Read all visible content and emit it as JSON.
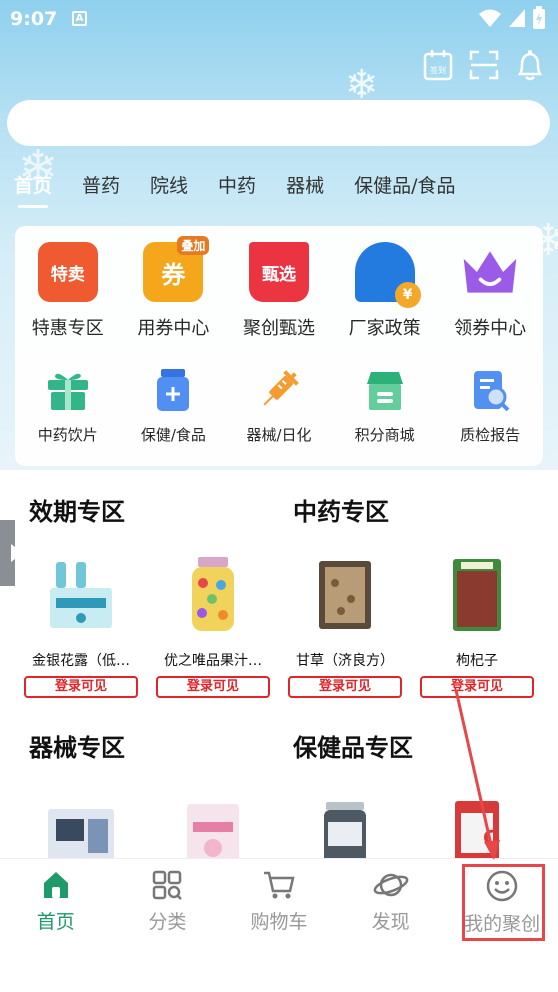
{
  "status": {
    "time": "9:07",
    "a_badge": "A"
  },
  "top_icons": {
    "sign_in": "签到"
  },
  "search": {
    "placeholder": ""
  },
  "category_tabs": [
    {
      "label": "首页",
      "active": true
    },
    {
      "label": "普药"
    },
    {
      "label": "院线"
    },
    {
      "label": "中药"
    },
    {
      "label": "器械"
    },
    {
      "label": "保健品/食品"
    }
  ],
  "shortcuts_big": [
    {
      "label": "特惠专区",
      "icon_text": "特卖",
      "icon": "sale-icon",
      "color": "#f0562a"
    },
    {
      "label": "用券中心",
      "icon_text": "券",
      "badge": "叠加",
      "icon": "coupon-icon",
      "color": "#f6a515"
    },
    {
      "label": "聚创甄选",
      "icon_text": "甄选",
      "icon": "cart-select-icon",
      "color": "#ec2f3c"
    },
    {
      "label": "厂家政策",
      "icon_text": "¥",
      "icon": "factory-policy-icon",
      "color": "#1e78e0"
    },
    {
      "label": "领券中心",
      "icon_text": "",
      "icon": "crown-icon",
      "color": "#9a57e8"
    }
  ],
  "shortcuts_small": [
    {
      "label": "中药饮片",
      "icon": "gift-box-icon",
      "color": "#2db586"
    },
    {
      "label": "保健/食品",
      "icon": "jar-icon",
      "color": "#4d8cf2"
    },
    {
      "label": "器械/日化",
      "icon": "syringe-icon",
      "color": "#f59a2a"
    },
    {
      "label": "积分商城",
      "icon": "store-icon",
      "color": "#27b074"
    },
    {
      "label": "质检报告",
      "icon": "report-icon",
      "color": "#4f8ef0"
    }
  ],
  "zones": [
    {
      "title": "效期专区",
      "products": [
        {
          "name": "金银花露（低…",
          "button": "登录可见"
        },
        {
          "name": "优之唯品果汁…",
          "button": "登录可见"
        }
      ]
    },
    {
      "title": "中药专区",
      "products": [
        {
          "name": "甘草（济良方）",
          "button": "登录可见"
        },
        {
          "name": "枸杞子",
          "button": "登录可见"
        }
      ]
    },
    {
      "title": "器械专区",
      "products": [
        {
          "name": ""
        },
        {
          "name": ""
        }
      ]
    },
    {
      "title": "保健品专区",
      "products": [
        {
          "name": ""
        },
        {
          "name": ""
        }
      ]
    }
  ],
  "bottom_nav": [
    {
      "label": "首页",
      "icon": "home-icon",
      "active": true
    },
    {
      "label": "分类",
      "icon": "category-grid-icon"
    },
    {
      "label": "购物车",
      "icon": "cart-icon"
    },
    {
      "label": "发现",
      "icon": "planet-icon"
    },
    {
      "label": "我的聚创",
      "icon": "smiley-icon"
    }
  ],
  "colors": {
    "accent": "#1f9a6a",
    "login_red": "#e0252b",
    "highlight": "#e8474a"
  }
}
